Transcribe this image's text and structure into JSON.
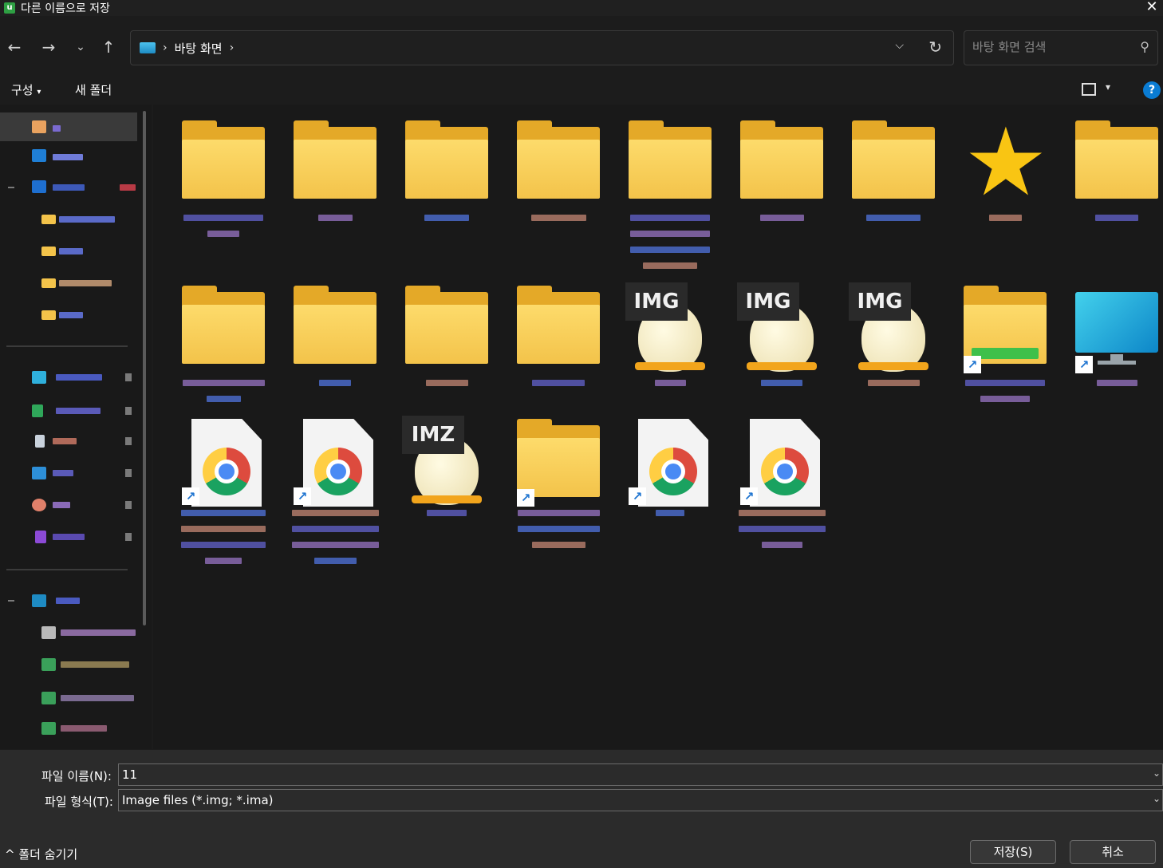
{
  "window": {
    "title": "다른 이름으로 저장",
    "app_icon_letter": "u"
  },
  "nav": {
    "breadcrumb": [
      "바탕 화면"
    ],
    "search_placeholder": "바탕 화면 검색"
  },
  "commands": {
    "organize": "구성",
    "new_folder": "새 폴더",
    "help": "?"
  },
  "content": {
    "items": [
      {
        "kind": "folder",
        "caption": ""
      },
      {
        "kind": "folder",
        "caption": ""
      },
      {
        "kind": "folder",
        "caption": ""
      },
      {
        "kind": "folder",
        "caption": ""
      },
      {
        "kind": "folder",
        "caption": ""
      },
      {
        "kind": "folder",
        "caption": ""
      },
      {
        "kind": "folder",
        "caption": ""
      },
      {
        "kind": "star",
        "caption": ""
      },
      {
        "kind": "folder",
        "caption": ""
      },
      {
        "kind": "folder",
        "caption": ""
      },
      {
        "kind": "folder",
        "caption": ""
      },
      {
        "kind": "folder",
        "caption": ""
      },
      {
        "kind": "folder",
        "caption": ""
      },
      {
        "kind": "img",
        "badge": "IMG",
        "caption": ""
      },
      {
        "kind": "img",
        "badge": "IMG",
        "caption": ""
      },
      {
        "kind": "img",
        "badge": "IMG",
        "caption": ""
      },
      {
        "kind": "drive-shortcut",
        "caption": ""
      },
      {
        "kind": "pc-shortcut",
        "caption": ""
      },
      {
        "kind": "chrome-shortcut",
        "caption": ""
      },
      {
        "kind": "chrome-shortcut",
        "caption": ""
      },
      {
        "kind": "img",
        "badge": "IMZ",
        "caption": ""
      },
      {
        "kind": "folder-shortcut",
        "caption": ""
      },
      {
        "kind": "chrome-shortcut",
        "caption": ""
      },
      {
        "kind": "chrome-shortcut",
        "caption": ""
      }
    ]
  },
  "form": {
    "filename_label": "파일 이름(N):",
    "filename_value": "11",
    "filetype_label": "파일 형식(T):",
    "filetype_value": "Image files (*.img; *.ima)"
  },
  "footer": {
    "hide_folders": "폴더 숨기기",
    "save": "저장(S)",
    "cancel": "취소"
  },
  "colors": {
    "accent": "#0a7cd3",
    "background": "#1c1c1c",
    "folder": "#f3c34a"
  }
}
